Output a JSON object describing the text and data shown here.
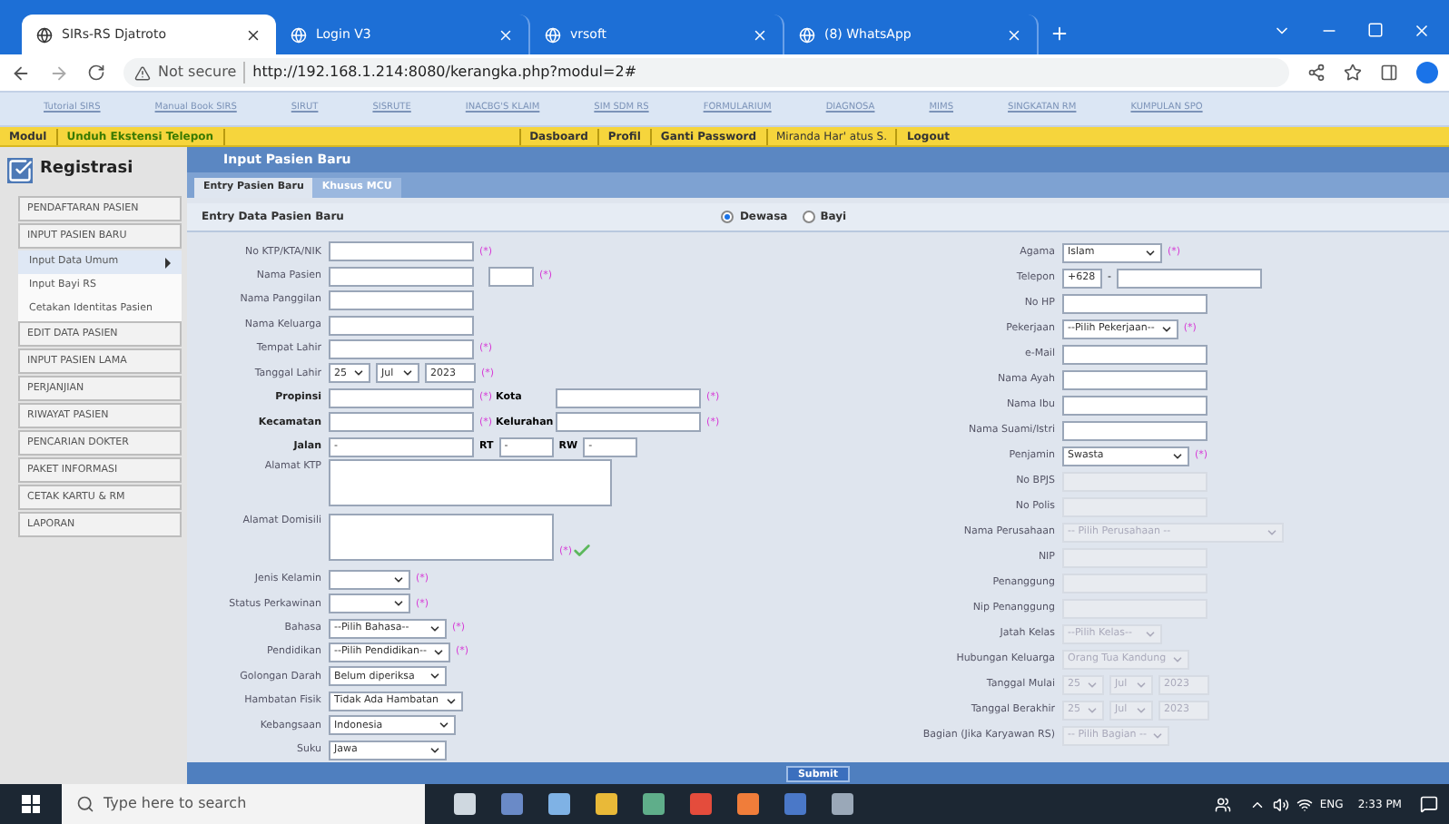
{
  "browser": {
    "tabs": [
      {
        "title": "SIRs-RS Djatroto",
        "selected": true
      },
      {
        "title": "Login V3",
        "selected": false
      },
      {
        "title": "vrsoft",
        "selected": false
      },
      {
        "title": "(8) WhatsApp",
        "selected": false
      }
    ],
    "security": "Not secure",
    "url": "http://192.168.1.214:8080/kerangka.php?modul=2#"
  },
  "bookmarks": [
    "Tutorial SIRS",
    "Manual Book SIRS",
    "SIRUT",
    "SISRUTE",
    "INACBG'S KLAIM",
    "SIM SDM RS",
    "FORMULARIUM",
    "DIAGNOSA",
    "MIMS",
    "SINGKATAN RM",
    "KUMPULAN SPO"
  ],
  "topbar": {
    "left": [
      "Modul",
      "Unduh Ekstensi Telepon"
    ],
    "right": [
      "Dasboard",
      "Profil",
      "Ganti Password",
      "Miranda Har' atus S.",
      "Logout"
    ]
  },
  "sidebar": {
    "title": "Registrasi",
    "items": [
      {
        "label": "PENDAFTARAN PASIEN"
      },
      {
        "label": "INPUT PASIEN BARU",
        "children": [
          {
            "label": "Input Data Umum",
            "selected": true
          },
          {
            "label": "Input Bayi RS",
            "selected": false
          },
          {
            "label": "Cetakan Identitas Pasien",
            "selected": false
          }
        ]
      },
      {
        "label": "EDIT DATA PASIEN"
      },
      {
        "label": "INPUT PASIEN LAMA"
      },
      {
        "label": "PERJANJIAN"
      },
      {
        "label": "RIWAYAT PASIEN"
      },
      {
        "label": "PENCARIAN DOKTER"
      },
      {
        "label": "PAKET INFORMASI"
      },
      {
        "label": "CETAK KARTU & RM"
      },
      {
        "label": "LAPORAN"
      }
    ]
  },
  "main": {
    "title": "Input Pasien Baru",
    "tabs": [
      {
        "label": "Entry Pasien Baru",
        "selected": true
      },
      {
        "label": "Khusus MCU",
        "selected": false
      }
    ],
    "section": "Entry Data Pasien Baru",
    "patient_type": [
      {
        "label": "Dewasa",
        "selected": true
      },
      {
        "label": "Bayi",
        "selected": false
      }
    ],
    "required_mark": "(*)",
    "left_fields": [
      {
        "kind": "text",
        "label": "No KTP/KTA/NIK",
        "required": true,
        "disabled": false
      },
      {
        "kind": "name",
        "label": "Nama Pasien",
        "required": true,
        "disabled": false
      },
      {
        "kind": "text",
        "label": "Nama Panggilan",
        "required": false,
        "disabled": false
      },
      {
        "kind": "text",
        "label": "Nama Keluarga",
        "required": false,
        "disabled": false
      },
      {
        "kind": "text",
        "label": "Tempat Lahir",
        "required": true,
        "disabled": false
      },
      {
        "kind": "date",
        "label": "Tanggal Lahir",
        "day": "25",
        "month": "Jul",
        "year": "2023",
        "required": true,
        "disabled": false
      },
      {
        "kind": "pair",
        "label": "Propinsi",
        "label2": "Kota",
        "required": true,
        "disabled": false
      },
      {
        "kind": "pair",
        "label": "Kecamatan",
        "label2": "Kelurahan",
        "required": true,
        "disabled": false
      },
      {
        "kind": "street",
        "label": "Jalan",
        "value": "-",
        "rt_label": "RT",
        "rt": "-",
        "rw_label": "RW",
        "rw": "-",
        "required": false,
        "disabled": false
      },
      {
        "kind": "textarea",
        "label": "Alamat KTP",
        "required": false,
        "disabled": false,
        "valid": false
      },
      {
        "kind": "textarea_small",
        "label": "Alamat Domisili",
        "required": true,
        "disabled": false,
        "valid": true
      },
      {
        "kind": "select",
        "label": "Jenis Kelamin",
        "required": true,
        "disabled": false
      },
      {
        "kind": "select",
        "label": "Status Perkawinan",
        "required": true,
        "disabled": false
      },
      {
        "kind": "select",
        "label": "Bahasa",
        "value": "--Pilih Bahasa--",
        "required": true,
        "disabled": false
      },
      {
        "kind": "select",
        "label": "Pendidikan",
        "value": "--Pilih Pendidikan--",
        "required": true,
        "disabled": false
      },
      {
        "kind": "select",
        "label": "Golongan Darah",
        "value": "Belum diperiksa",
        "required": false,
        "disabled": false
      },
      {
        "kind": "select",
        "label": "Hambatan Fisik",
        "value": "Tidak Ada Hambatan",
        "required": false,
        "disabled": false
      },
      {
        "kind": "select_wide",
        "label": "Kebangsaan",
        "value": "Indonesia",
        "required": false,
        "disabled": false
      },
      {
        "kind": "select",
        "label": "Suku",
        "value": "Jawa",
        "required": false,
        "disabled": false
      }
    ],
    "right_fields": [
      {
        "kind": "select",
        "label": "Agama",
        "value": "Islam",
        "required": true,
        "disabled": false
      },
      {
        "kind": "phone",
        "label": "Telepon",
        "prefix": "+628",
        "separator": "-",
        "required": false,
        "disabled": false
      },
      {
        "kind": "text",
        "label": "No HP",
        "required": false,
        "disabled": false
      },
      {
        "kind": "select",
        "label": "Pekerjaan",
        "value": "--Pilih Pekerjaan--",
        "required": true,
        "disabled": false
      },
      {
        "kind": "text",
        "label": "e-Mail",
        "required": false,
        "disabled": false
      },
      {
        "kind": "text",
        "label": "Nama Ayah",
        "required": false,
        "disabled": false
      },
      {
        "kind": "text",
        "label": "Nama Ibu",
        "required": false,
        "disabled": false
      },
      {
        "kind": "text",
        "label": "Nama Suami/Istri",
        "required": false,
        "disabled": false
      },
      {
        "kind": "select_wide",
        "label": "Penjamin",
        "value": "Swasta",
        "required": true,
        "disabled": false
      },
      {
        "kind": "text",
        "label": "No BPJS",
        "required": false,
        "disabled": true
      },
      {
        "kind": "text",
        "label": "No Polis",
        "required": false,
        "disabled": true
      },
      {
        "kind": "select_xwide",
        "label": "Nama Perusahaan",
        "value": "-- Pilih Perusahaan --",
        "required": false,
        "disabled": true
      },
      {
        "kind": "text",
        "label": "NIP",
        "required": false,
        "disabled": true
      },
      {
        "kind": "text",
        "label": "Penanggung",
        "required": false,
        "disabled": true
      },
      {
        "kind": "text",
        "label": "Nip Penanggung",
        "required": false,
        "disabled": true
      },
      {
        "kind": "select",
        "label": "Jatah Kelas",
        "value": "--Pilih Kelas--",
        "required": false,
        "disabled": true
      },
      {
        "kind": "select",
        "label": "Hubungan Keluarga",
        "value": "Orang Tua Kandung",
        "required": false,
        "disabled": true
      },
      {
        "kind": "date",
        "label": "Tanggal Mulai",
        "day": "25",
        "month": "Jul",
        "year": "2023",
        "required": false,
        "disabled": true
      },
      {
        "kind": "date",
        "label": "Tanggal Berakhir",
        "day": "25",
        "month": "Jul",
        "year": "2023",
        "required": false,
        "disabled": true
      },
      {
        "kind": "select",
        "label": "Bagian (Jika Karyawan RS)",
        "value": "-- Pilih Bagian --",
        "required": false,
        "disabled": true
      }
    ],
    "submit": "Submit"
  },
  "taskbar": {
    "search_placeholder": "Type here to search",
    "language": "ENG",
    "time": "2:33 PM"
  }
}
